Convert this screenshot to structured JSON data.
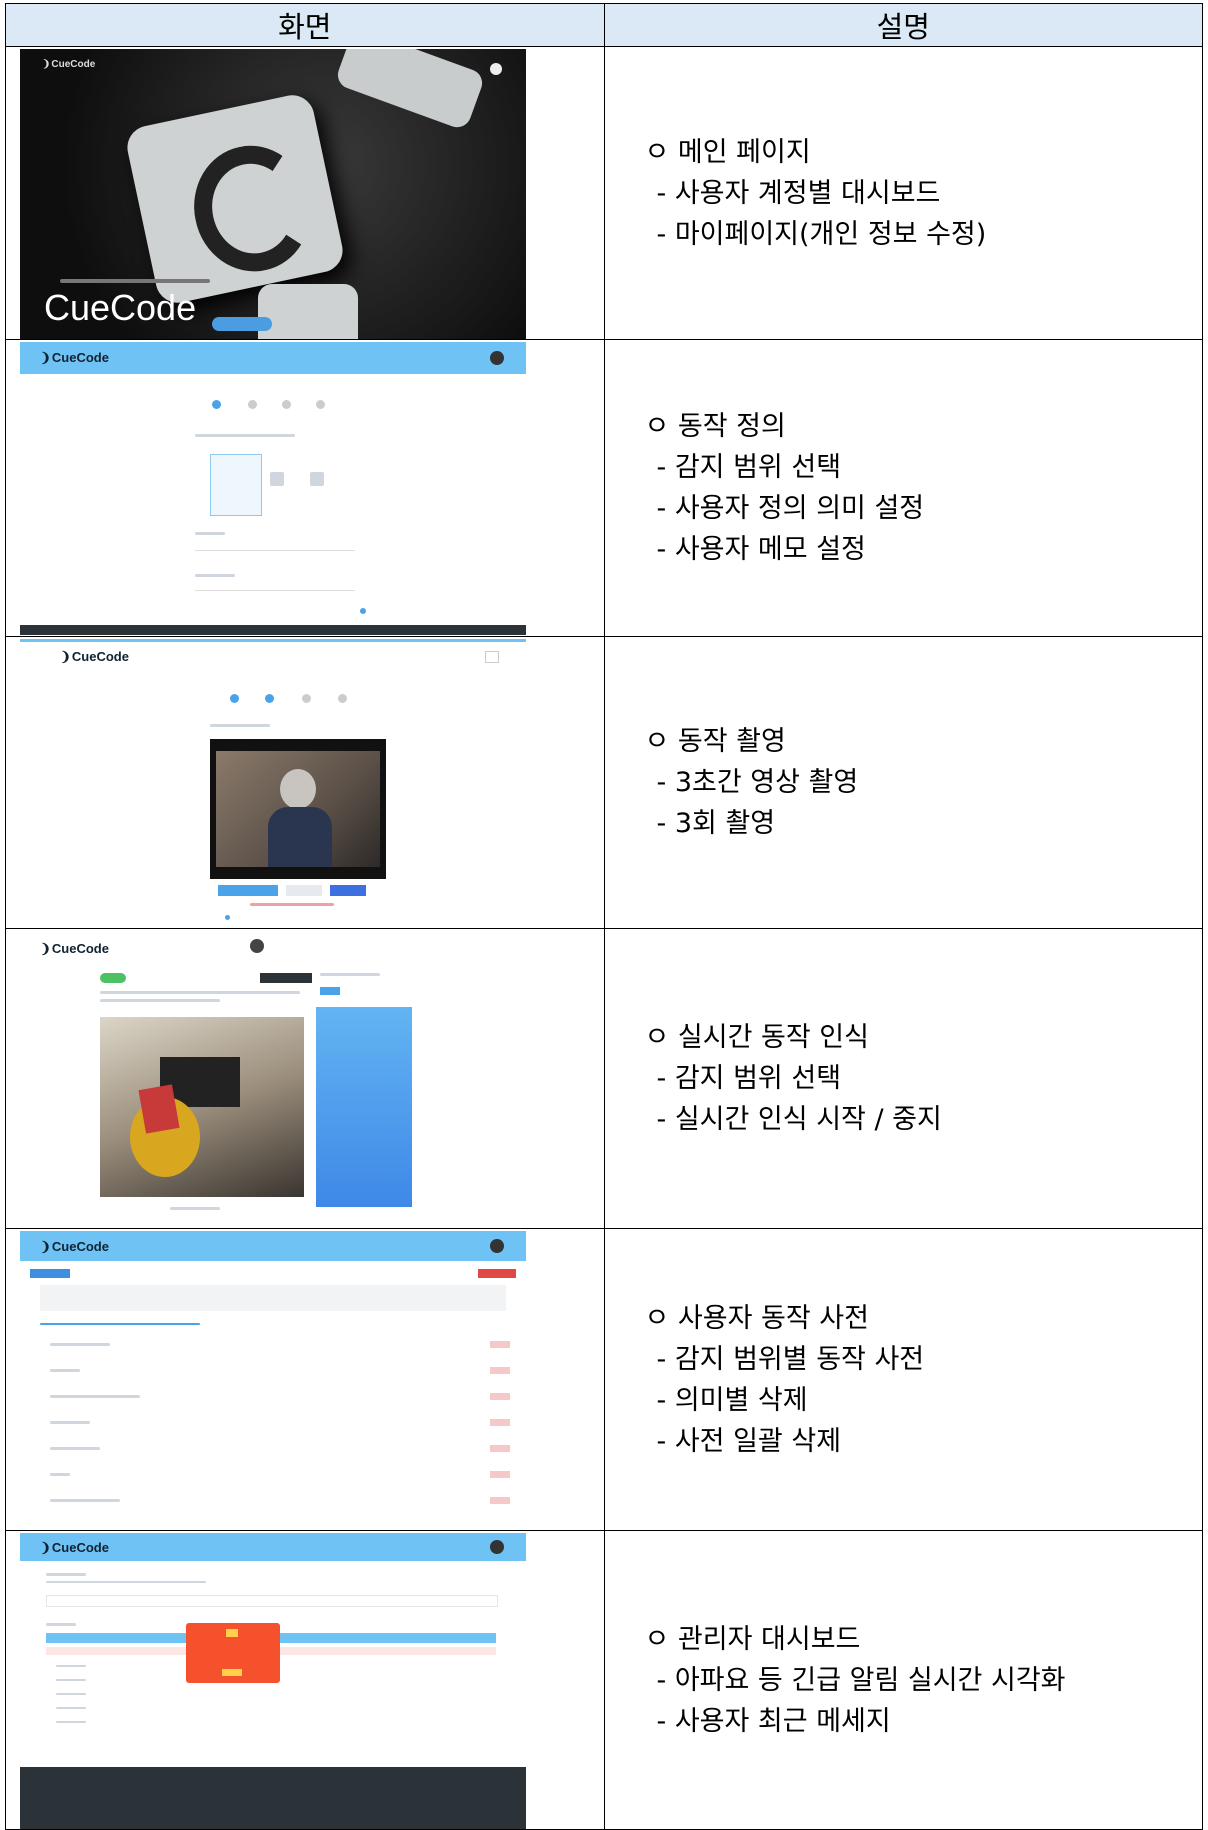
{
  "headers": {
    "screen": "화면",
    "description": "설명"
  },
  "rows": [
    {
      "shot": {
        "logo": "CueCode",
        "hero_title": "CueCode"
      },
      "title": "ㅇ 메인 페이지",
      "items": [
        "- 사용자 계정별 대시보드",
        "- 마이페이지(개인 정보 수정)"
      ]
    },
    {
      "shot": {
        "logo": "CueCode"
      },
      "title": "ㅇ 동작 정의",
      "items": [
        "- 감지 범위 선택",
        "- 사용자 정의 의미 설정",
        "- 사용자 메모 설정"
      ]
    },
    {
      "shot": {
        "logo": "CueCode"
      },
      "title": "ㅇ 동작 촬영",
      "items": [
        "- 3초간 영상 촬영",
        "- 3회 촬영"
      ]
    },
    {
      "shot": {
        "logo": "CueCode"
      },
      "title": "ㅇ 실시간 동작 인식",
      "items": [
        "- 감지 범위 선택",
        "- 실시간 인식 시작 / 중지"
      ]
    },
    {
      "shot": {
        "logo": "CueCode"
      },
      "title": "ㅇ 사용자 동작 사전",
      "items": [
        "- 감지 범위별 동작 사전",
        "- 의미별 삭제",
        "- 사전 일괄 삭제"
      ]
    },
    {
      "shot": {
        "logo": "CueCode"
      },
      "title": "ㅇ 관리자 대시보드",
      "items": [
        "- 아파요 등 긴급 알림 실시간 시각화",
        "- 사용자 최근 메세지"
      ]
    }
  ],
  "colors": {
    "header_bg": "#dae9f5",
    "app_header": "#6ec3f4",
    "alert": "#f4512c",
    "footer": "#2b3238"
  }
}
